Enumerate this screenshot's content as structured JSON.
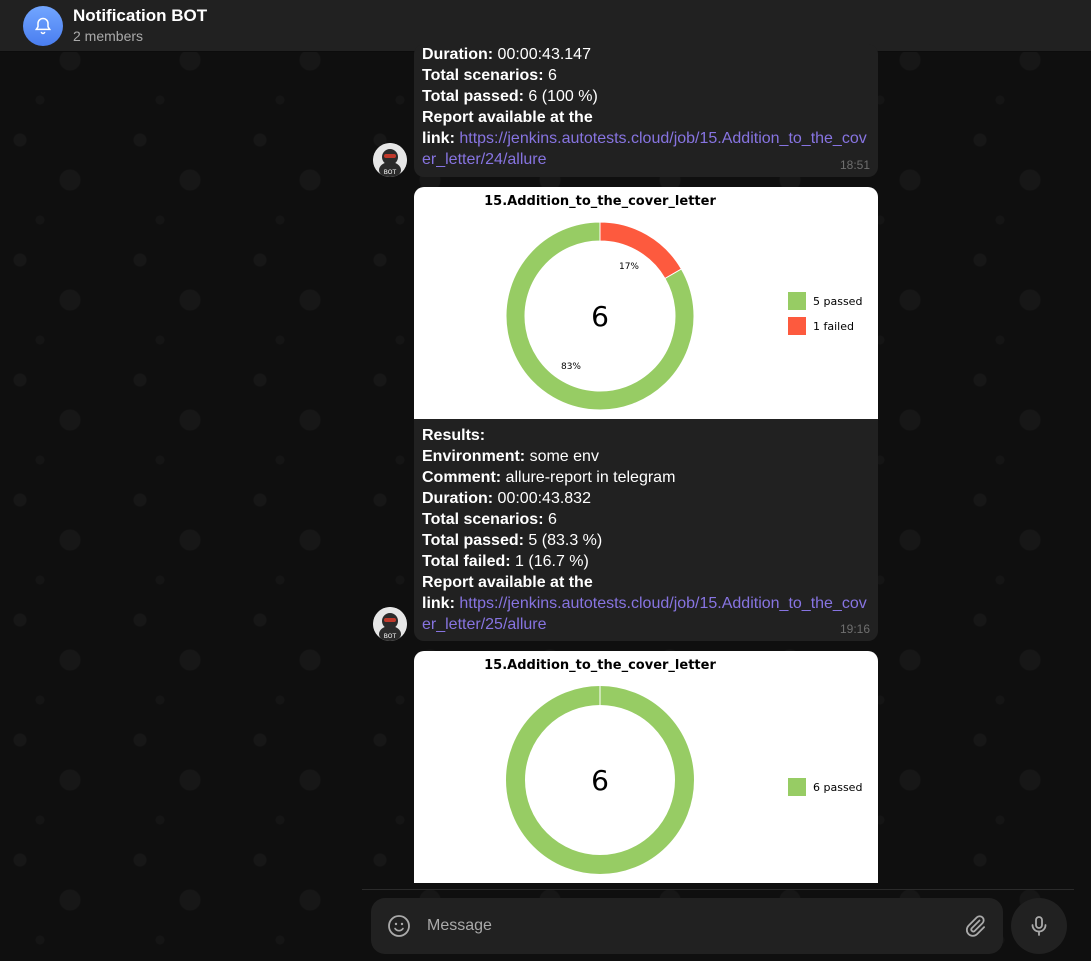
{
  "header": {
    "title": "Notification BOT",
    "subtitle": "2 members"
  },
  "messages": [
    {
      "lines": [
        {
          "label": "Duration:",
          "value": " 00:00:43.147"
        },
        {
          "label": "Total scenarios:",
          "value": " 6"
        },
        {
          "label": "Total passed:",
          "value": " 6 (100 %)"
        },
        {
          "label": "Report available at the",
          "value": ""
        }
      ],
      "link_label": "link:",
      "link": "https://jenkins.autotests.cloud/job/15.Addition_to_the_cover_letter/24/allure",
      "time": "18:51",
      "avatar_text": "BOT"
    },
    {
      "lines": [
        {
          "label": "Results:",
          "value": ""
        },
        {
          "label": "Environment:",
          "value": " some env"
        },
        {
          "label": "Comment:",
          "value": " allure-report in telegram"
        },
        {
          "label": "Duration:",
          "value": " 00:00:43.832"
        },
        {
          "label": "Total scenarios:",
          "value": " 6"
        },
        {
          "label": "Total passed:",
          "value": " 5 (83.3 %)"
        },
        {
          "label": "Total failed:",
          "value": " 1 (16.7 %)"
        },
        {
          "label": "Report available at the",
          "value": ""
        }
      ],
      "link_label": "link:",
      "link": "https://jenkins.autotests.cloud/job/15.Addition_to_the_cover_letter/25/allure",
      "time": "19:16",
      "avatar_text": "BOT"
    }
  ],
  "chart_data": [
    {
      "type": "pie",
      "title": "15.Addition_to_the_cover_letter",
      "center_label": "6",
      "slices": [
        {
          "name": "passed",
          "value": 5,
          "label": "83%"
        },
        {
          "name": "failed",
          "value": 1,
          "label": "17%"
        }
      ],
      "legend": [
        "5 passed",
        "1 failed"
      ],
      "colors": [
        "#97cc64",
        "#fd5a3e"
      ],
      "legend_position": "right"
    },
    {
      "type": "pie",
      "title": "15.Addition_to_the_cover_letter",
      "center_label": "6",
      "slices": [
        {
          "name": "passed",
          "value": 6,
          "label": ""
        }
      ],
      "legend": [
        "6 passed"
      ],
      "colors": [
        "#97cc64"
      ],
      "legend_position": "right"
    }
  ],
  "composer": {
    "placeholder": "Message"
  },
  "icons": {
    "chat_avatar": "bell-icon",
    "emoji": "smile-icon",
    "attach": "paperclip-icon",
    "mic": "microphone-icon"
  },
  "colors": {
    "link": "#8774e1",
    "bubble": "#212121",
    "header": "#212121"
  }
}
